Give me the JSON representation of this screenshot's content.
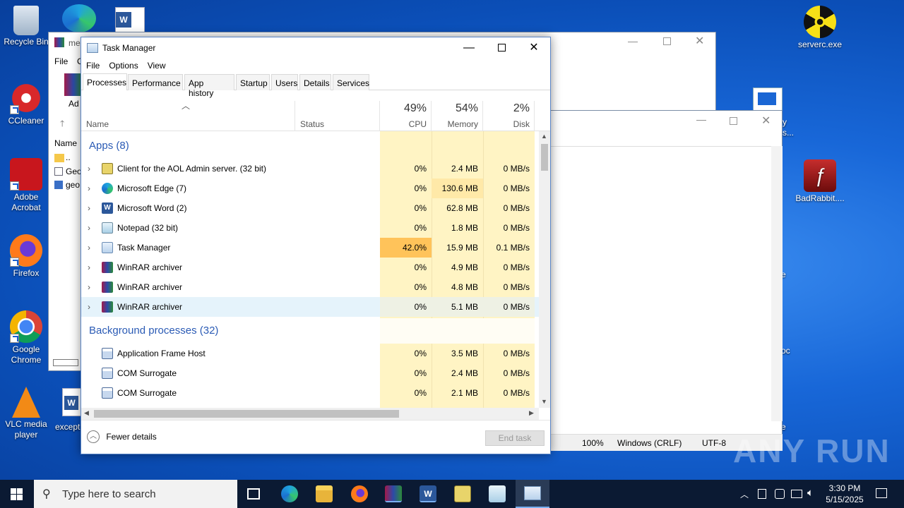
{
  "desktop_icons": [
    {
      "label": "Recycle Bin"
    },
    {
      "label": "CCleaner"
    },
    {
      "label": "Adobe Acrobat"
    },
    {
      "label": "Firefox"
    },
    {
      "label": "Google Chrome"
    },
    {
      "label": "VLC media player"
    },
    {
      "label": "serverc.exe"
    },
    {
      "label": "BadRabbit...."
    }
  ],
  "bg_window": {
    "menu_file": "File",
    "folder_row": "..",
    "row1": "Geo",
    "row2": "geo",
    "name_col": "Name",
    "title_part": "me",
    "toolbar_partial": "Ad",
    "menu_partial": "C"
  },
  "notepad_status": {
    "zoom": "100%",
    "eol": "Windows (CRLF)",
    "encoding": "UTF-8"
  },
  "desktop_partial": {
    "y_text": "y",
    "s_text": "s...",
    "e1": "e",
    "oc": "oc",
    "e2": "e",
    "exception": "except"
  },
  "task_manager": {
    "title": "Task Manager",
    "menu": [
      "File",
      "Options",
      "View"
    ],
    "tabs": [
      "Processes",
      "Performance",
      "App history",
      "Startup",
      "Users",
      "Details",
      "Services"
    ],
    "columns": {
      "name": "Name",
      "status": "Status",
      "cpu_pct": "49%",
      "cpu": "CPU",
      "mem_pct": "54%",
      "mem": "Memory",
      "disk_pct": "2%",
      "disk": "Disk"
    },
    "groups": {
      "apps": "Apps (8)",
      "background": "Background processes (32)"
    },
    "apps": [
      {
        "name": "Client for the AOL Admin server. (32 bit)",
        "cpu": "0%",
        "mem": "2.4 MB",
        "disk": "0 MB/s"
      },
      {
        "name": "Microsoft Edge (7)",
        "cpu": "0%",
        "mem": "130.6 MB",
        "disk": "0 MB/s"
      },
      {
        "name": "Microsoft Word (2)",
        "cpu": "0%",
        "mem": "62.8 MB",
        "disk": "0 MB/s"
      },
      {
        "name": "Notepad (32 bit)",
        "cpu": "0%",
        "mem": "1.8 MB",
        "disk": "0 MB/s"
      },
      {
        "name": "Task Manager",
        "cpu": "42.0%",
        "mem": "15.9 MB",
        "disk": "0.1 MB/s"
      },
      {
        "name": "WinRAR archiver",
        "cpu": "0%",
        "mem": "4.9 MB",
        "disk": "0 MB/s"
      },
      {
        "name": "WinRAR archiver",
        "cpu": "0%",
        "mem": "4.8 MB",
        "disk": "0 MB/s"
      },
      {
        "name": "WinRAR archiver",
        "cpu": "0%",
        "mem": "5.1 MB",
        "disk": "0 MB/s"
      }
    ],
    "background": [
      {
        "name": "Application Frame Host",
        "cpu": "0%",
        "mem": "3.5 MB",
        "disk": "0 MB/s"
      },
      {
        "name": "COM Surrogate",
        "cpu": "0%",
        "mem": "2.4 MB",
        "disk": "0 MB/s"
      },
      {
        "name": "COM Surrogate",
        "cpu": "0%",
        "mem": "2.1 MB",
        "disk": "0 MB/s"
      }
    ],
    "fewer_details": "Fewer details",
    "end_task": "End task"
  },
  "taskbar": {
    "search_placeholder": "Type here to search",
    "time": "3:30 PM",
    "date": "5/15/2025"
  },
  "watermark": "ANY RUN",
  "colors": {
    "accent": "#2b5bb5",
    "heat_light": "#fff4c4",
    "heat_mid": "#ffe9a8",
    "heat_high": "#ffc35a"
  }
}
